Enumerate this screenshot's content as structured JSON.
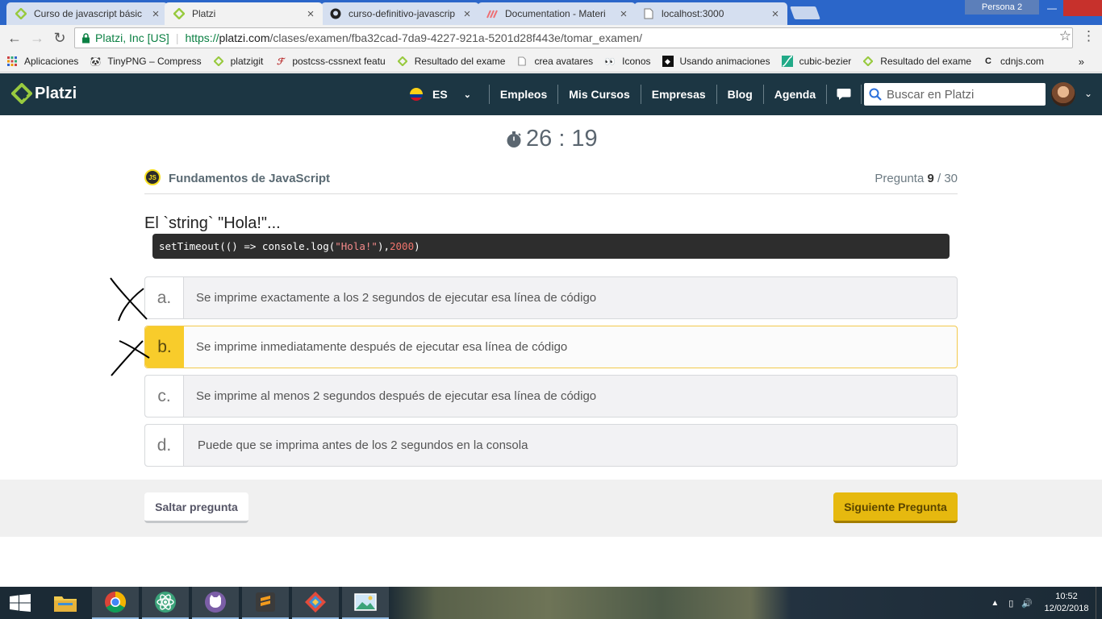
{
  "browser": {
    "tabs": [
      {
        "title": "Curso de javascript básic",
        "icon": "platzi-favicon"
      },
      {
        "title": "Platzi",
        "icon": "platzi-favicon",
        "active": true
      },
      {
        "title": "curso-definitivo-javascrip",
        "icon": "github-favicon"
      },
      {
        "title": "Documentation - Materi",
        "icon": "materialize-favicon"
      },
      {
        "title": "localhost:3000",
        "icon": "page-favicon"
      }
    ],
    "persona": "Persona 2",
    "secure_label": "Platzi, Inc [US]",
    "url_scheme": "https://",
    "url_host": "platzi.com",
    "url_path": "/clases/examen/fba32cad-7da9-4227-921a-5201d28f443e/tomar_examen/",
    "bookmarks": [
      {
        "label": "Aplicaciones",
        "icon": "apps-grid-icon"
      },
      {
        "label": "TinyPNG – Compress",
        "icon": "panda-icon"
      },
      {
        "label": "platzigit",
        "icon": "platzi-icon"
      },
      {
        "label": "postcss-cssnext featu",
        "icon": "postcss-icon"
      },
      {
        "label": "Resultado del exame",
        "icon": "platzi-icon"
      },
      {
        "label": "crea avatares",
        "icon": "page-icon"
      },
      {
        "label": "Iconos",
        "icon": "eyes-icon"
      },
      {
        "label": "Usando animaciones",
        "icon": "mdn-icon"
      },
      {
        "label": "cubic-bezier",
        "icon": "curve-icon"
      },
      {
        "label": "Resultado del exame",
        "icon": "platzi-icon"
      },
      {
        "label": "cdnjs.com",
        "icon": "cdnjs-icon"
      }
    ]
  },
  "header": {
    "logo": "Platzi",
    "lang": "ES",
    "nav": [
      "Empleos",
      "Mis Cursos",
      "Empresas",
      "Blog",
      "Agenda"
    ],
    "search_placeholder": "Buscar en Platzi"
  },
  "exam": {
    "timer": "26 : 19",
    "course_badge": "JS",
    "course_name": "Fundamentos de JavaScript",
    "counter_label": "Pregunta ",
    "counter_current": "9",
    "counter_total": " / 30",
    "question": "El `string` \"Hola!\"...",
    "code": {
      "prefix": "setTimeout(() => console.log(",
      "string": "\"Hola!\"",
      "middle": "), ",
      "number": "2000",
      "suffix": ")"
    },
    "options": [
      {
        "letter": "a.",
        "text": "Se imprime exactamente a los 2 segundos de ejecutar esa línea de código"
      },
      {
        "letter": "b.",
        "text": "Se imprime inmediatamente después de ejecutar esa línea de código",
        "selected": true
      },
      {
        "letter": "c.",
        "text": "Se imprime al menos 2 segundos después de ejecutar esa línea de código"
      },
      {
        "letter": "d.",
        "text": "Puede que se imprima antes de los 2 segundos en la consola"
      }
    ],
    "skip_label": "Saltar pregunta",
    "next_label": "Siguiente Pregunta"
  },
  "taskbar": {
    "time": "10:52",
    "date": "12/02/2018"
  },
  "colors": {
    "header_bg": "#1c3643",
    "accent_yellow": "#f8cc2b",
    "platzi_green": "#98ca3f"
  }
}
